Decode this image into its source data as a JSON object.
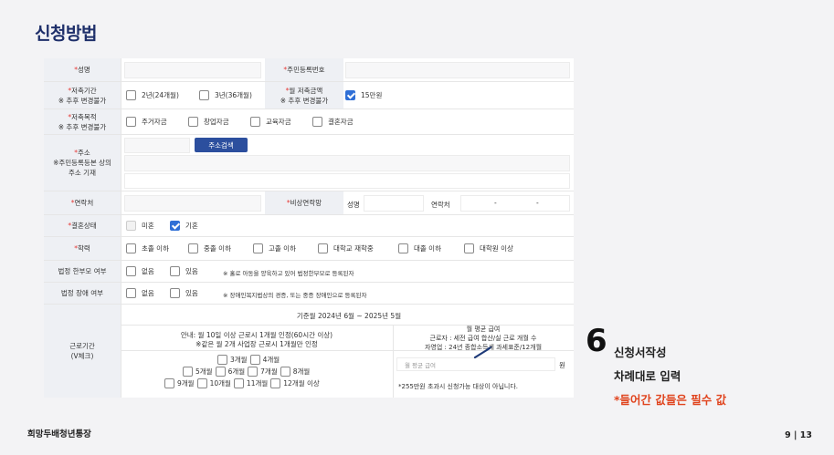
{
  "page_title": "신청방법",
  "form": {
    "name": {
      "label": "성명",
      "ssn_label": "주민등록번호"
    },
    "saving_period": {
      "label": "저축기간",
      "note": "※ 추후 변경불가",
      "options": [
        "2년(24개월)",
        "3년(36개월)"
      ],
      "monthly_label": "월 저축금액",
      "monthly_note": "※ 추후 변경불가",
      "monthly_option": "15만원"
    },
    "purpose": {
      "label": "저축목적",
      "note": "※ 추후 변경불가",
      "options": [
        "주거자금",
        "창업자금",
        "교육자금",
        "결혼자금"
      ]
    },
    "address": {
      "label": "주소",
      "note": "※주민등록등본 상의 주소 기재",
      "search_button": "주소검색"
    },
    "contact": {
      "label": "연락처",
      "emergency_label": "비상연락망",
      "emergency_name_label": "성명",
      "emergency_phone_label": "연락처",
      "phone_sep1": "-",
      "phone_sep2": "-"
    },
    "marital": {
      "label": "결혼상태",
      "options": [
        "미혼",
        "기혼"
      ]
    },
    "education": {
      "label": "학력",
      "options": [
        "초졸 이하",
        "중졸 이하",
        "고졸 이하",
        "대학교 재학중",
        "대졸 이하",
        "대학원 이상"
      ]
    },
    "single_parent": {
      "label": "법정 한부모 여부",
      "options": [
        "없음",
        "있음"
      ],
      "note": "※ 홀로 아동을 양육하고 있어 법정한부모로 등록된자"
    },
    "disability": {
      "label": "법정 장애 여부",
      "options": [
        "없음",
        "있음"
      ],
      "note": "※ 장애인복지법상의 경증, 또는 중증 장애인으로 등록된자"
    },
    "work_period": {
      "label": "근로기간",
      "sublabel": "(V체크)",
      "reference": "기준월 2024년 6월 ~ 2025년 5월",
      "guide_line1": "안내: 월 10일 이상 근로시 1개월 인정(60시간 이상)",
      "guide_line2": "※같은 월 2개 사업장 근로시 1개월만 인정",
      "avg_title": "월 평균 급여",
      "avg_line1": "근로자 : 세전 급여 합산/실 근로 개월 수",
      "avg_line2": "자영업 : 24년 종합소득세 과세표준/12개월",
      "months": [
        "3개월",
        "4개월",
        "5개월",
        "6개월",
        "7개월",
        "8개월",
        "9개월",
        "10개월",
        "11개월",
        "12개월 이상"
      ],
      "avg_placeholder": "월 평균 급여",
      "won": "원",
      "limit_note": "*255만원 초과시 신청가능 대상이 아닙니다."
    }
  },
  "side": {
    "step_number": "6",
    "line1": "신청서작성",
    "line2": "차례대로 입력",
    "line3": "*들어간 값들은 필수 값"
  },
  "footer": {
    "left": "희망두배청년통장",
    "right": "9 | 13"
  }
}
